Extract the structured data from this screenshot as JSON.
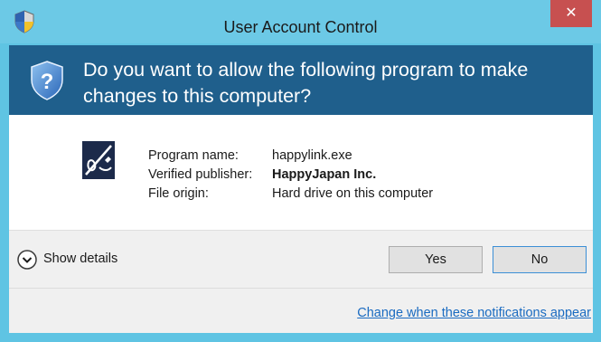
{
  "window": {
    "title": "User Account Control",
    "close_label": "✕"
  },
  "banner": {
    "question": "Do you want to allow the following program to make changes to this computer?"
  },
  "program": {
    "labels": {
      "name": "Program name:",
      "publisher": "Verified publisher:",
      "origin": "File origin:"
    },
    "values": {
      "name": "happylink.exe",
      "publisher": "HappyJapan Inc.",
      "origin": "Hard drive on this computer"
    },
    "icon": "program-icon"
  },
  "actions": {
    "details_label": "Show details",
    "yes_label": "Yes",
    "no_label": "No"
  },
  "footer": {
    "link_text": "Change when these notifications appear"
  },
  "colors": {
    "titlebar": "#6cc9e6",
    "banner": "#1f5f8c",
    "close": "#c75050",
    "link": "#1a6bc1"
  }
}
